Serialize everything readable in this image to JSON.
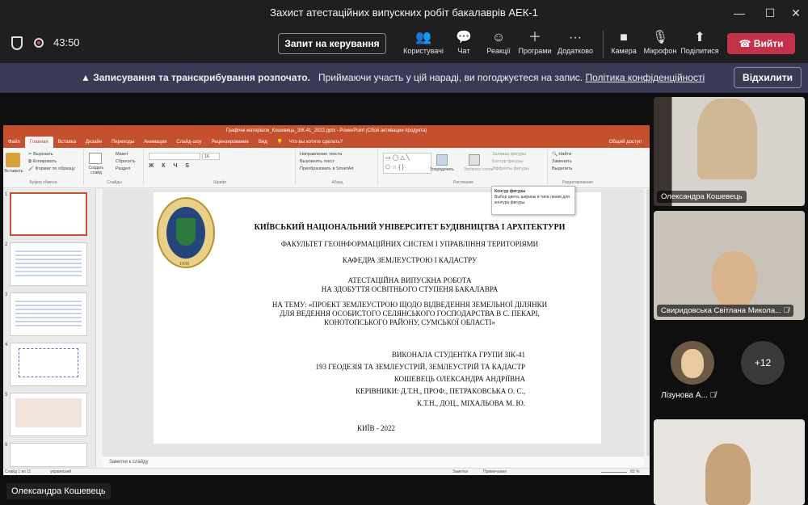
{
  "window": {
    "title": "Захист атестаційних випускних робіт бакалаврів АЕК-1",
    "minimize": "—",
    "maximize": "☐",
    "close": "✕"
  },
  "toolbar": {
    "timer": "43:50",
    "request_control": "Запит на керування",
    "items": [
      {
        "label": "Користувачі",
        "icon": "people-icon"
      },
      {
        "label": "Чат",
        "icon": "chat-icon"
      },
      {
        "label": "Реакції",
        "icon": "reactions-icon"
      },
      {
        "label": "Програми",
        "icon": "apps-icon"
      },
      {
        "label": "Додатково",
        "icon": "more-icon"
      },
      {
        "label": "Камера",
        "icon": "camera-icon"
      },
      {
        "label": "Мікрофон",
        "icon": "mic-off-icon"
      },
      {
        "label": "Поділитися",
        "icon": "share-icon"
      }
    ],
    "leave": "Вийти"
  },
  "banner": {
    "bold": "Записування та транскрибування розпочато.",
    "text": "Приймаючи участь у цій нараді, ви погоджуєтеся на запис.",
    "link": "Політика конфіденційності",
    "dismiss": "Відхилити"
  },
  "ppt": {
    "title": "Графічні матеріали_Кошевець_ЗІК-41_2022.pptx - PowerPoint (Сбой активации продукта)",
    "tabs": [
      "Файл",
      "Главная",
      "Вставка",
      "Дизайн",
      "Переходы",
      "Анимация",
      "Слайд-шоу",
      "Рецензирование",
      "Вид"
    ],
    "search": "Что вы хотите сделать?",
    "share": "Общий доступ",
    "ribbon": {
      "clipboard": {
        "paste": "Вставить",
        "cut": "Вырезать",
        "copy": "Копировать",
        "format": "Формат по образцу",
        "label": "Буфер обмена"
      },
      "slides": {
        "new": "Создать слайд",
        "layout": "Макет",
        "reset": "Сбросить",
        "section": "Раздел",
        "label": "Слайды"
      },
      "font": {
        "label": "Шрифт",
        "size": "16"
      },
      "paragraph": {
        "dir": "Направление текста",
        "align": "Выровнять текст",
        "smartart": "Преобразовать в SmartArt",
        "label": "Абзац"
      },
      "drawing": {
        "arrange": "Упорядочить",
        "styles": "Экспресс-стили",
        "fill": "Заливка фигуры",
        "outline": "Контур фигуры",
        "effects": "Эффекты фигуры",
        "label": "Рисование"
      },
      "editing": {
        "find": "Найти",
        "replace": "Заменить",
        "select": "Выделить",
        "label": "Редактирование"
      }
    },
    "tooltip": {
      "title": "Контур фигуры",
      "text": "Выбор цвета, ширины и типа линии для контура фигуры."
    },
    "thumb_numbers": [
      "1",
      "2",
      "3",
      "4",
      "5",
      "6"
    ],
    "slide": {
      "university": "КИЇВСЬКИЙ НАЦІОНАЛЬНИЙ УНІВЕРСИТЕТ БУДІВНИЦТВА І АРХІТЕКТУРИ",
      "faculty": "ФАКУЛЬТЕТ ГЕОІНФОРМАЦІЙНИХ СИСТЕМ І УПРАВЛІННЯ ТЕРИТОРІЯМИ",
      "department": "КАФЕДРА ЗЕМЛЕУСТРОЮ І КАДАСТРУ",
      "work1": "АТЕСТАЦІЙНА ВИПУСКНА РОБОТА",
      "work2": "НА ЗДОБУТТЯ ОСВІТНЬОГО СТУПЕНЯ БАКАЛАВРА",
      "topic1": "НА ТЕМУ: «ПРОЕКТ ЗЕМЛЕУСТРОЮ ЩОДО ВІДВЕДЕННЯ ЗЕМЕЛЬНОЇ ДІЛЯНКИ",
      "topic2": "ДЛЯ ВЕДЕННЯ ОСОБИСТОГО СЕЛЯНСЬКОГО ГОСПОДАРСТВА В С. ПЕКАРІ,",
      "topic3": "КОНОТОПСЬКОГО РАЙОНУ, СУМСЬКОЇ ОБЛАСТІ»",
      "author1": "ВИКОНАЛА СТУДЕНТКА ГРУПИ ЗІК-41",
      "author2": "193 ГЕОДЕЗІЯ ТА ЗЕМЛЕУСТРІЙ, ЗЕМЛЕУСТРІЙ ТА КАДАСТР",
      "author3": "КОШЕВЕЦЬ ОЛЕКСАНДРА АНДРІЇВНА",
      "supervisor1": "КЕРІВНИКИ: Д.Т.Н., ПРОФ., ПЕТРАКОВСЬКА О. С.,",
      "supervisor2": "К.Т.Н., ДОЦ., МІХАЛЬОВА М. Ю.",
      "city": "КИЇВ - 2022",
      "emblem_year": "1930"
    },
    "notes": "Заметки к слайду",
    "status": {
      "slide": "Слайд 1 из 11",
      "lang": "украинский",
      "notes": "Заметки",
      "comments": "Примечания",
      "zoom": "83 %"
    }
  },
  "presenter_name": "Олександра Кошевець",
  "participants": [
    {
      "name": "Олександра Кошевець"
    },
    {
      "name": "Свиридовська Світлана Микола..."
    },
    {
      "name": "Лізунова А..."
    },
    {
      "name": "+12"
    }
  ]
}
